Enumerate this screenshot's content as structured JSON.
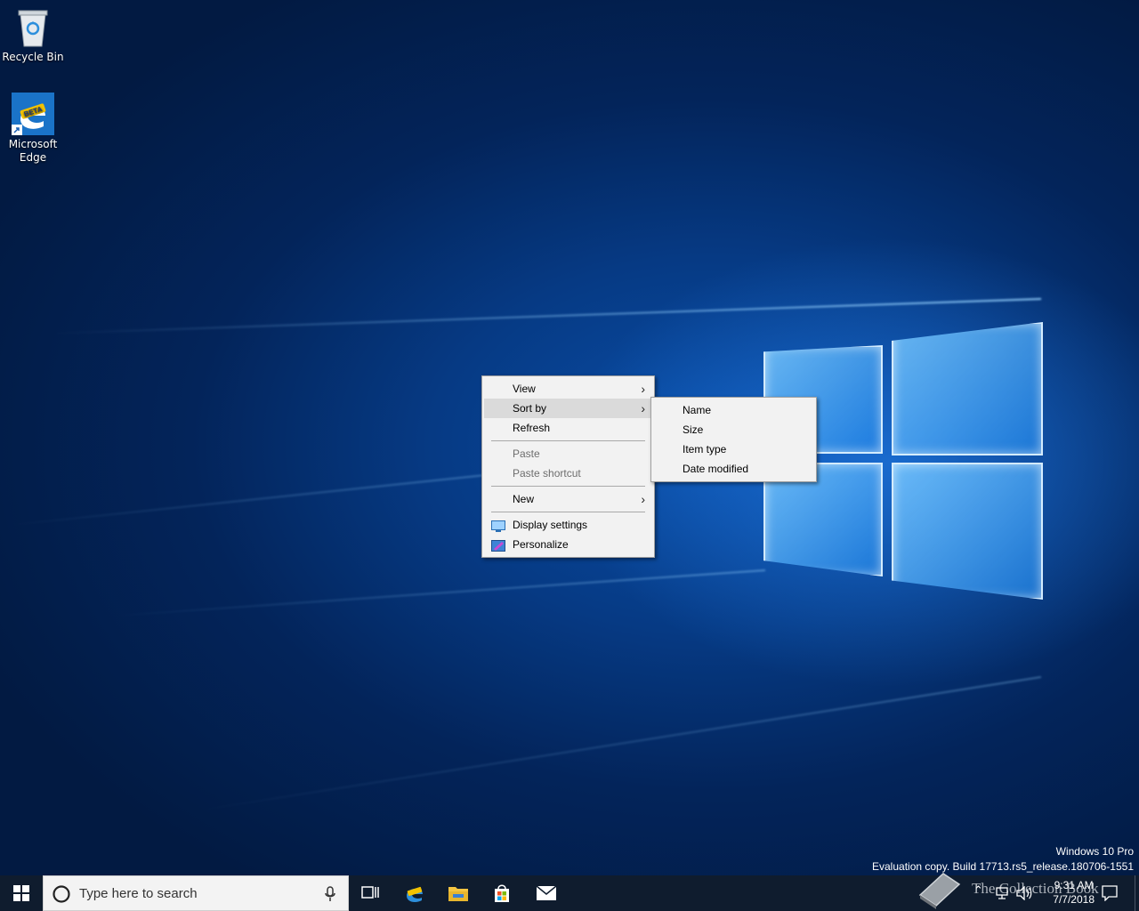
{
  "desktop": {
    "icons": [
      {
        "label": "Recycle Bin",
        "icon": "recycle-bin-icon"
      },
      {
        "label": "Microsoft Edge",
        "icon": "edge-beta-icon"
      }
    ],
    "watermark": {
      "line1": "Windows 10 Pro",
      "line2": "Evaluation copy. Build 17713.rs5_release.180706-1551"
    }
  },
  "context_menu": {
    "items": {
      "view": "View",
      "sort_by": "Sort by",
      "refresh": "Refresh",
      "paste": "Paste",
      "paste_shortcut": "Paste shortcut",
      "new": "New",
      "display_settings": "Display settings",
      "personalize": "Personalize"
    },
    "hovered": "Sort by"
  },
  "sort_submenu": {
    "items": [
      "Name",
      "Size",
      "Item type",
      "Date modified"
    ]
  },
  "taskbar": {
    "search_placeholder": "Type here to search",
    "pinned": [
      "task-view-icon",
      "edge-beta-icon",
      "file-explorer-icon",
      "store-icon",
      "mail-icon"
    ],
    "clock": {
      "time": "9:31 AM",
      "date": "7/7/2018"
    },
    "overlay_text": "The Collection Book"
  }
}
